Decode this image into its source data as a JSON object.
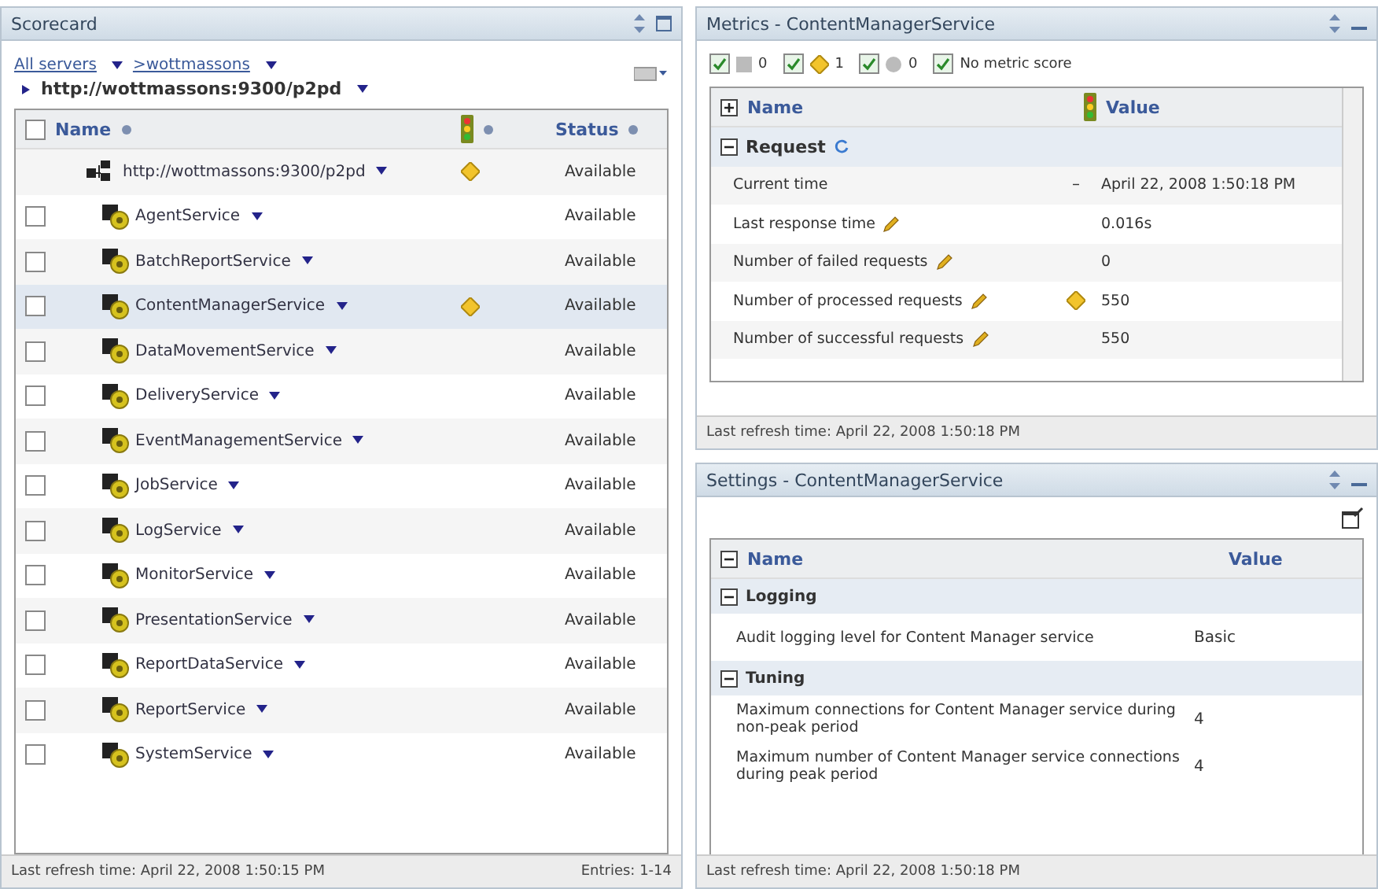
{
  "scorecard": {
    "title": "Scorecard",
    "breadcrumb": [
      {
        "label": "All servers"
      },
      {
        "label": ">wottmassons"
      }
    ],
    "path": "http://wottmassons:9300/p2pd",
    "columns": {
      "name": "Name",
      "status": "Status"
    },
    "all_selected": false,
    "rows": [
      {
        "name": "http://wottmassons:9300/p2pd",
        "kind": "server",
        "flagged": true,
        "status": "Available",
        "selected": false
      },
      {
        "name": "AgentService",
        "kind": "service",
        "flagged": false,
        "status": "Available",
        "selected": false
      },
      {
        "name": "BatchReportService",
        "kind": "service",
        "flagged": false,
        "status": "Available",
        "selected": false
      },
      {
        "name": "ContentManagerService",
        "kind": "service",
        "flagged": true,
        "status": "Available",
        "selected": true
      },
      {
        "name": "DataMovementService",
        "kind": "service",
        "flagged": false,
        "status": "Available",
        "selected": false
      },
      {
        "name": "DeliveryService",
        "kind": "service",
        "flagged": false,
        "status": "Available",
        "selected": false
      },
      {
        "name": "EventManagementService",
        "kind": "service",
        "flagged": false,
        "status": "Available",
        "selected": false
      },
      {
        "name": "JobService",
        "kind": "service",
        "flagged": false,
        "status": "Available",
        "selected": false
      },
      {
        "name": "LogService",
        "kind": "service",
        "flagged": false,
        "status": "Available",
        "selected": false
      },
      {
        "name": "MonitorService",
        "kind": "service",
        "flagged": false,
        "status": "Available",
        "selected": false
      },
      {
        "name": "PresentationService",
        "kind": "service",
        "flagged": false,
        "status": "Available",
        "selected": false
      },
      {
        "name": "ReportDataService",
        "kind": "service",
        "flagged": false,
        "status": "Available",
        "selected": false
      },
      {
        "name": "ReportService",
        "kind": "service",
        "flagged": false,
        "status": "Available",
        "selected": false
      },
      {
        "name": "SystemService",
        "kind": "service",
        "flagged": false,
        "status": "Available",
        "selected": false
      }
    ],
    "footer": "Last refresh time: April 22, 2008 1:50:15 PM",
    "entries": "Entries: 1-14"
  },
  "metrics": {
    "title": "Metrics - ContentManagerService",
    "filters": [
      {
        "kind": "square",
        "count": "0",
        "checked": true
      },
      {
        "kind": "diamond",
        "count": "1",
        "checked": true
      },
      {
        "kind": "circle",
        "count": "0",
        "checked": true
      },
      {
        "kind": "text",
        "label": "No metric score",
        "checked": true
      }
    ],
    "columns": {
      "name": "Name",
      "value": "Value"
    },
    "group": "Request",
    "rows": [
      {
        "name": "Current time",
        "editable": false,
        "indicator": "–",
        "flagged": false,
        "value": "April 22, 2008 1:50:18 PM"
      },
      {
        "name": "Last response time",
        "editable": true,
        "flagged": false,
        "value": "0.016s"
      },
      {
        "name": "Number of failed requests",
        "editable": true,
        "flagged": false,
        "value": "0"
      },
      {
        "name": "Number of processed requests",
        "editable": true,
        "flagged": true,
        "value": "550"
      },
      {
        "name": "Number of successful requests",
        "editable": true,
        "flagged": false,
        "value": "550"
      }
    ],
    "footer": "Last refresh time: April 22, 2008 1:50:18 PM"
  },
  "settings": {
    "title": "Settings - ContentManagerService",
    "columns": {
      "name": "Name",
      "value": "Value"
    },
    "groups": [
      {
        "name": "Logging",
        "expanded": true,
        "rows": [
          {
            "name": "Audit logging level for Content Manager service",
            "value": "Basic"
          }
        ]
      },
      {
        "name": "Tuning",
        "expanded": true,
        "rows": [
          {
            "name": "Maximum connections for Content Manager service during non-peak period",
            "value": "4"
          },
          {
            "name": "Maximum number of Content Manager service connections during peak period",
            "value": "4"
          }
        ]
      }
    ],
    "footer": "Last refresh time: April 22, 2008 1:50:18 PM"
  }
}
